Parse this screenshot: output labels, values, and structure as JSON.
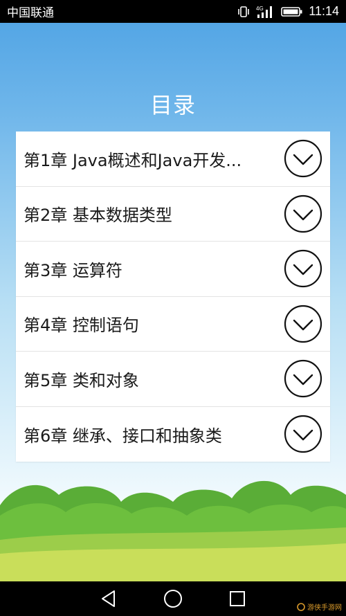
{
  "status_bar": {
    "carrier": "中国联通",
    "network_type": "4G",
    "time": "11:14"
  },
  "page": {
    "title": "目录"
  },
  "chapters": [
    {
      "label": "第1章 Java概述和Java开发..."
    },
    {
      "label": "第2章 基本数据类型"
    },
    {
      "label": "第3章 运算符"
    },
    {
      "label": "第4章 控制语句"
    },
    {
      "label": "第5章 类和对象"
    },
    {
      "label": "第6章 继承、接口和抽象类"
    }
  ],
  "watermark": {
    "text": "游侠手游网"
  },
  "colors": {
    "sky_top": "#54a6e5",
    "sky_bottom": "#f4fbfe",
    "hill_green": "#6dbf3e",
    "ground_green": "#c9de5a"
  },
  "icons": {
    "chapter_expand": "chevron-down-circle-icon",
    "nav_back": "triangle-back-icon",
    "nav_home": "circle-home-icon",
    "nav_recent": "square-recent-icon"
  }
}
